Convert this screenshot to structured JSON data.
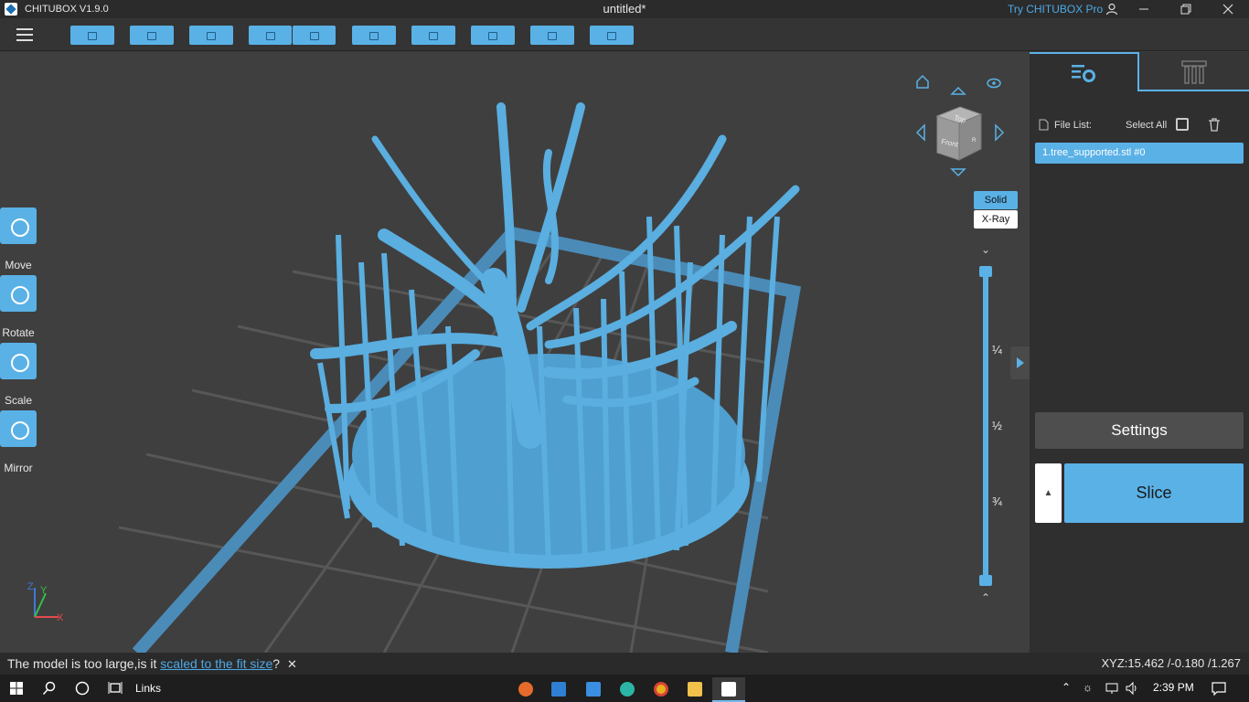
{
  "titlebar": {
    "app_name": "CHITUBOX V1.9.0",
    "document_title": "untitled*",
    "try_pro": "Try CHITUBOX Pro",
    "user_icon": "user-icon",
    "minimize_icon": "minimize-icon",
    "restore_icon": "restore-icon",
    "close_icon": "close-icon"
  },
  "toolbar": {
    "menu_icon": "hamburger-menu-icon",
    "buttons": [
      {
        "icon": "open-file-icon"
      },
      {
        "icon": "save-icon"
      },
      {
        "icon": "screenshot-icon"
      },
      {
        "icon": "undo-icon"
      },
      {
        "icon": "redo-icon"
      },
      {
        "icon": "copy-icon"
      },
      {
        "icon": "arrange-icon"
      },
      {
        "icon": "support-icon"
      },
      {
        "icon": "hollow-icon"
      },
      {
        "icon": "dig-hole-icon"
      }
    ]
  },
  "left_tools": [
    {
      "label": "Move",
      "icon": "move-icon"
    },
    {
      "label": "Rotate",
      "icon": "rotate-icon"
    },
    {
      "label": "Scale",
      "icon": "scale-icon"
    },
    {
      "label": "Mirror",
      "icon": "mirror-icon"
    }
  ],
  "view_cube": {
    "top_label": "Top",
    "front_label": "Front",
    "right_label": "R"
  },
  "render_modes": {
    "solid": "Solid",
    "xray": "X-Ray",
    "selected": "Solid"
  },
  "layer_slider": {
    "quarter": "¼",
    "half": "½",
    "three_quarter": "¾"
  },
  "right_panel": {
    "file_list_label": "File List:",
    "select_all_label": "Select All",
    "files": [
      "1.tree_supported.stl #0"
    ],
    "settings_label": "Settings",
    "slice_label": "Slice"
  },
  "statusbar": {
    "message_prefix": "The model is too large,is it ",
    "message_link": "scaled to the fit size",
    "message_suffix": "?",
    "coords": "XYZ:15.462 /-0.180 /1.267"
  },
  "axes": {
    "x": "X",
    "y": "Y",
    "z": "Z"
  },
  "taskbar": {
    "links_label": "Links",
    "time": "2:39 PM"
  },
  "colors": {
    "accent": "#5ab1e6",
    "model": "#5aaee0",
    "background": "#3f3f3f"
  }
}
